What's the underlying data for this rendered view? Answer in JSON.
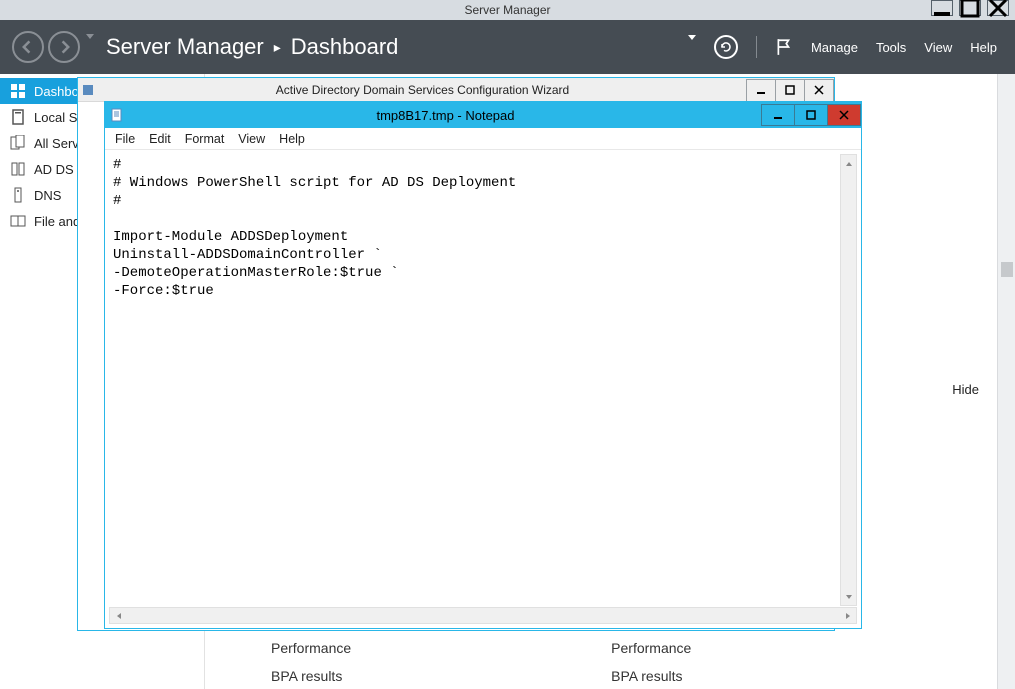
{
  "serverManager": {
    "title": "Server Manager",
    "breadcrumb": {
      "app": "Server Manager",
      "page": "Dashboard"
    },
    "menu": {
      "manage": "Manage",
      "tools": "Tools",
      "view": "View",
      "help": "Help"
    }
  },
  "sidebar": {
    "items": [
      {
        "label": "Dashboard"
      },
      {
        "label": "Local Server"
      },
      {
        "label": "All Servers"
      },
      {
        "label": "AD DS"
      },
      {
        "label": "DNS"
      },
      {
        "label": "File and Storage Services"
      }
    ]
  },
  "content": {
    "hide": "Hide",
    "tile": {
      "perf": "Performance",
      "bpa": "BPA results"
    }
  },
  "wizard": {
    "title": "Active Directory Domain Services Configuration Wizard"
  },
  "notepad": {
    "title": "tmp8B17.tmp - Notepad",
    "menu": {
      "file": "File",
      "edit": "Edit",
      "format": "Format",
      "view": "View",
      "help": "Help"
    },
    "text": "#\n# Windows PowerShell script for AD DS Deployment\n#\n\nImport-Module ADDSDeployment\nUninstall-ADDSDomainController `\n-DemoteOperationMasterRole:$true `\n-Force:$true\n"
  },
  "winButtons": {
    "min": "–",
    "max": "□",
    "close": "✕"
  }
}
